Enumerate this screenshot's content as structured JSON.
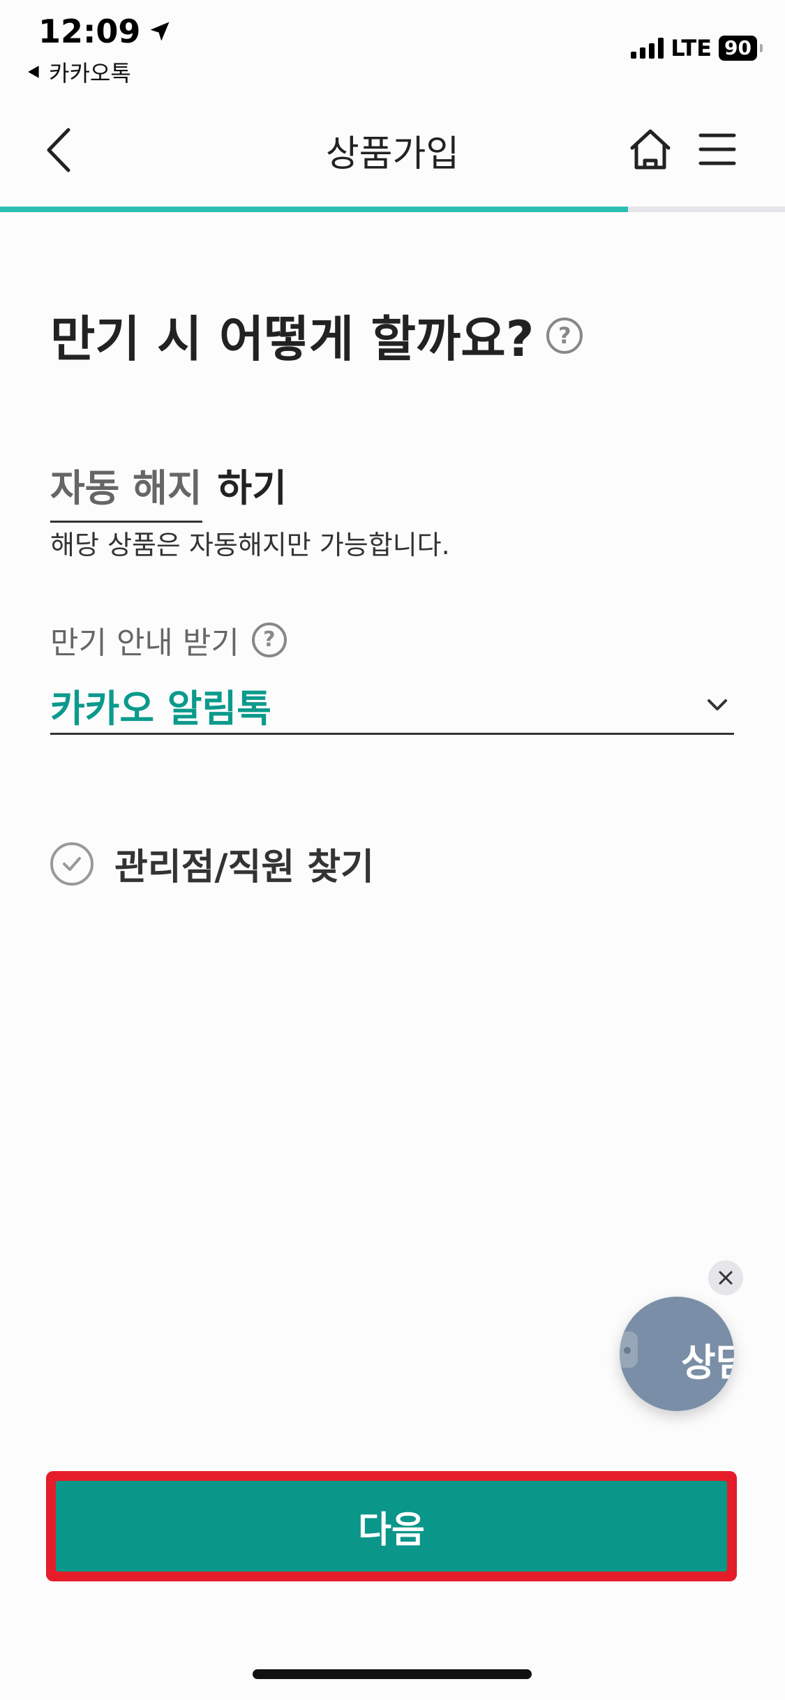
{
  "status_bar": {
    "time": "12:09",
    "back_app": "카카오톡",
    "network": "LTE",
    "battery": "90"
  },
  "header": {
    "title": "상품가입"
  },
  "progress": {
    "fraction": 0.8,
    "fill_color": "#2bbfb0"
  },
  "content": {
    "question": "만기 시 어떻게 할까요?",
    "help_glyph": "?",
    "option_value": "자동 해지",
    "option_suffix": "하기",
    "note": "해당 상품은 자동해지만 가능합니다.",
    "notice_label": "만기 안내 받기",
    "notice_select_value": "카카오 알림톡",
    "find_manager": "관리점/직원 찾기"
  },
  "float_chat": {
    "label": "상담"
  },
  "footer": {
    "next_label": "다음",
    "highlight_color": "#e51d2a",
    "button_color": "#0b968a"
  }
}
